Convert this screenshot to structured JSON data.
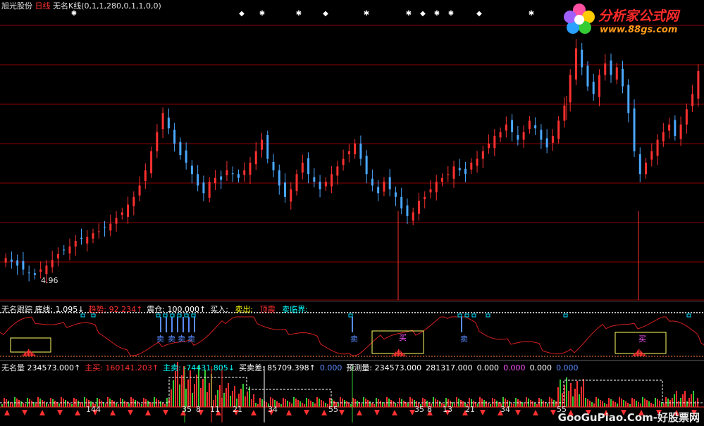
{
  "header": {
    "stock_name": "旭光股份",
    "period": "日线",
    "indicator": "无名K线(0,1,1,280,0,1,1,0,0)"
  },
  "logo": {
    "text": "分析家公式网",
    "url": "www.88gs.com"
  },
  "watermark": "GooGuPiao.Com-好股票网",
  "price_low_label": "4.96",
  "panel2": {
    "name": "无名跟踪",
    "items": [
      {
        "label": "底线:",
        "value": "1.095",
        "arrow": "↓",
        "color": "#ffffff"
      },
      {
        "label": "趋势:",
        "value": "92.234",
        "arrow": "↑",
        "color": "#ff3030"
      },
      {
        "label": "震仓:",
        "value": "100.000",
        "arrow": "↑",
        "color": "#ffffff"
      },
      {
        "label": "买入:",
        "value": "",
        "arrow": "",
        "color": "#ffffff"
      },
      {
        "label": "卖出:",
        "value": "",
        "arrow": "",
        "color": "#ffff00"
      },
      {
        "label": "顶震",
        "value": "",
        "arrow": "",
        "color": "#ff3030"
      },
      {
        "label": "卖临界:",
        "value": "",
        "arrow": "",
        "color": "#00ffff"
      }
    ],
    "sell_signal": "卖",
    "buy_signal": "买"
  },
  "panel3": {
    "name": "无名量",
    "items": [
      {
        "label": "",
        "value": "234573.000",
        "arrow": "↑",
        "color": "#ffffff"
      },
      {
        "label": "主买:",
        "value": "160141.203",
        "arrow": "↑",
        "color": "#ff3030"
      },
      {
        "label": "主卖:",
        "value": "-74431.805",
        "arrow": "↓",
        "color": "#00ffff"
      },
      {
        "label": "买卖差:",
        "value": "85709.398",
        "arrow": "↑",
        "color": "#ffffff"
      },
      {
        "label": "",
        "value": "0.000",
        "arrow": "",
        "color": "#5a8cff"
      },
      {
        "label": "预测量:",
        "value": "234573.000",
        "arrow": "",
        "color": "#ffffff"
      },
      {
        "label": "",
        "value": "281317.000",
        "arrow": "",
        "color": "#ffffff"
      },
      {
        "label": "",
        "value": "0.000",
        "arrow": "",
        "color": "#ffffff"
      },
      {
        "label": "",
        "value": "0.000",
        "arrow": "",
        "color": "#ff55ff"
      },
      {
        "label": "",
        "value": "0.000",
        "arrow": "",
        "color": "#ffffff"
      },
      {
        "label": "",
        "value": "0.000",
        "arrow": "",
        "color": "#5a8cff"
      }
    ],
    "bottom_ticks": [
      "144",
      "35",
      "8",
      "11",
      "21",
      "34",
      "55",
      "35",
      "8",
      "13",
      "21",
      "34",
      "55"
    ]
  },
  "colors": {
    "up": "#ff3030",
    "down": "#4aa8ff",
    "grid": "#8b0000",
    "panel_divider": "#c0c0c0",
    "trend_line": "#d42020",
    "box": "#ffff66"
  },
  "chart_data": {
    "type": "candlestick",
    "title": "旭光股份 日线",
    "price_series": [
      5.4,
      5.3,
      5.2,
      5.1,
      5.0,
      4.96,
      5.1,
      5.2,
      5.35,
      5.5,
      5.6,
      5.7,
      5.85,
      5.9,
      5.95,
      6.05,
      6.1,
      6.2,
      6.3,
      6.45,
      6.6,
      6.8,
      7.0,
      7.3,
      7.7,
      8.2,
      8.7,
      9.2,
      8.8,
      8.4,
      8.1,
      7.9,
      7.6,
      7.3,
      7.1,
      7.4,
      7.5,
      7.45,
      7.7,
      7.6,
      7.5,
      7.7,
      7.9,
      8.2,
      8.5,
      8.0,
      7.7,
      7.3,
      7.0,
      7.2,
      7.6,
      7.9,
      7.6,
      7.4,
      7.2,
      7.4,
      7.6,
      7.8,
      8.0,
      8.2,
      8.4,
      8.0,
      7.6,
      7.3,
      7.1,
      7.4,
      7.2,
      7.0,
      6.7,
      6.5,
      6.6,
      6.9,
      7.0,
      7.2,
      7.4,
      7.5,
      7.6,
      7.8,
      7.7,
      7.6,
      7.9,
      8.0,
      8.2,
      8.4,
      8.6,
      8.7,
      8.9,
      8.7,
      8.5,
      8.7,
      9.0,
      8.8,
      8.5,
      8.3,
      8.6,
      9.0,
      9.4,
      10.2,
      10.9,
      10.4,
      9.9,
      9.7,
      10.2,
      10.5,
      10.2,
      10.4,
      9.9,
      9.2,
      8.2,
      7.6,
      7.9,
      8.2,
      8.5,
      8.7,
      8.9,
      8.6,
      8.9,
      9.3,
      9.7,
      10.3
    ]
  }
}
